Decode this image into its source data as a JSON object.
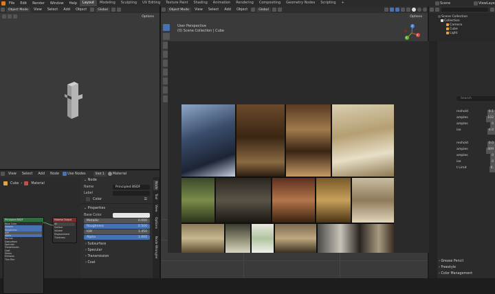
{
  "topbar": {
    "menus": [
      "File",
      "Edit",
      "Render",
      "Window",
      "Help"
    ],
    "workspaces": [
      "Layout",
      "Modeling",
      "Sculpting",
      "UV Editing",
      "Texture Paint",
      "Shading",
      "Animation",
      "Rendering",
      "Compositing",
      "Geometry Nodes",
      "Scripting"
    ],
    "active_workspace": "Layout",
    "add_tab": "+",
    "scene_label": "Scene",
    "viewlayer_label": "ViewLayer"
  },
  "left_viewport": {
    "mode": "Object Mode",
    "menus": [
      "View",
      "Select",
      "Add",
      "Object"
    ],
    "orientation": "Global",
    "options_label": "Options"
  },
  "main_viewport": {
    "mode": "Object Mode",
    "menus": [
      "View",
      "Select",
      "Add",
      "Object"
    ],
    "orientation": "Global",
    "options_label": "Options",
    "view_name": "User Perspective",
    "collection_path": "(0) Scene Collection | Cube",
    "axis_labels": {
      "x": "X",
      "y": "Y",
      "z": "Z"
    }
  },
  "node_editor": {
    "menus": [
      "View",
      "Select",
      "Add",
      "Node"
    ],
    "use_nodes_label": "Use Nodes",
    "slot_label": "Slot 1",
    "material_label": "Material",
    "breadcrumb": [
      "Cube",
      "Material"
    ],
    "node_bsdf_title": "Principled BSDF",
    "node_output_title": "Material Output",
    "bsdf_sockets": [
      "Base Color",
      "Metallic",
      "Roughness",
      "IOR",
      "Alpha",
      "Normal",
      "Subsurface",
      "Specular",
      "Transmission",
      "Coat",
      "Sheen",
      "Emission",
      "Thin Film"
    ],
    "output_sockets": [
      "All",
      "Surface",
      "Volume",
      "Displacement",
      "Thickness"
    ]
  },
  "node_sidebar": {
    "section_node": "Node",
    "name_label": "Name",
    "name_value": "Principled BSDF",
    "label_label": "Label",
    "color_label": "Color",
    "properties_label": "Properties",
    "base_color_label": "Base Color",
    "base_color_hex": "#e6e6e6",
    "fields": [
      {
        "label": "Metallic",
        "value": "0.000",
        "highlight": false
      },
      {
        "label": "Roughness",
        "value": "0.500",
        "highlight": true
      },
      {
        "label": "IOR",
        "value": "1.450",
        "highlight": false
      },
      {
        "label": "Alpha",
        "value": "1.000",
        "highlight": true
      }
    ],
    "subpanels": [
      "Subsurface",
      "Specular",
      "Transmission",
      "Coat"
    ],
    "tabs": [
      "Node",
      "Tool",
      "View",
      "Options",
      "Node Wrangler"
    ]
  },
  "outliner": {
    "rows": [
      {
        "label": "Scene Collection",
        "indent": 0
      },
      {
        "label": "Collection",
        "indent": 1
      },
      {
        "label": "Camera",
        "indent": 2
      },
      {
        "label": "Cube",
        "indent": 2
      },
      {
        "label": "Light",
        "indent": 2
      }
    ]
  },
  "properties": {
    "search_placeholder": "Search",
    "partial_labels": [
      "reshold",
      "amples",
      "amples",
      "ise",
      "reshold",
      "amples",
      "amples",
      "ise",
      "t Limit"
    ],
    "partial_values": [
      "0.1",
      "102",
      "0",
      "0.0",
      "0.0",
      "409",
      "0",
      "0",
      "0."
    ],
    "bottom_panels": [
      "Grease Pencil",
      "Freestyle",
      "Color Management"
    ]
  },
  "image_overlay": {
    "background": "#2a2a2a"
  },
  "colors": {
    "accent_blue": "#4772b3",
    "header_bg": "#2e2e2e",
    "viewport_bg": "#3a3a3a",
    "node_bg": "#2b2b2b",
    "bsdf_header": "#2c6e3d",
    "output_header": "#7a2f2f"
  }
}
